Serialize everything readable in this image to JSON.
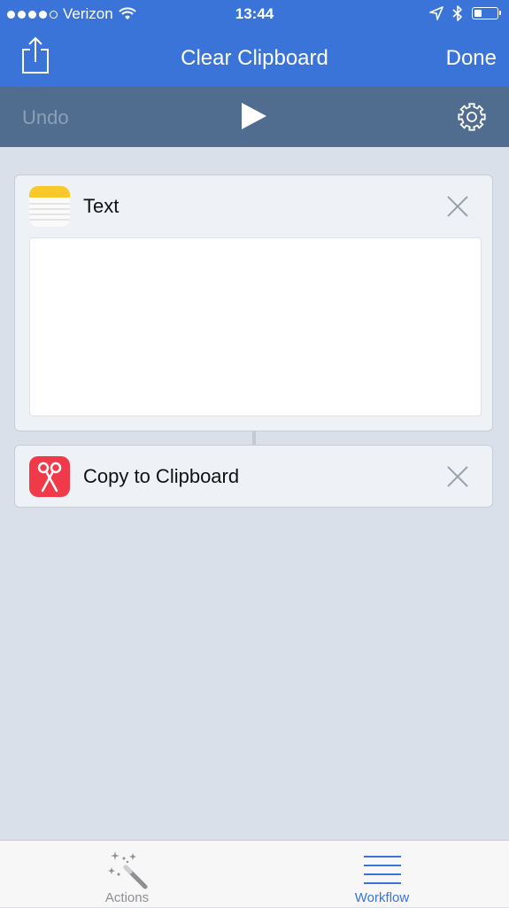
{
  "status_bar": {
    "carrier": "Verizon",
    "time": "13:44",
    "signal_filled": 4,
    "signal_total": 5,
    "battery_level": 0.35
  },
  "nav": {
    "title": "Clear Clipboard",
    "done_label": "Done",
    "share_icon": "share-icon"
  },
  "toolbar": {
    "undo_label": "Undo",
    "play_icon": "play-icon",
    "settings_icon": "gear-icon"
  },
  "actions": [
    {
      "label": "Text",
      "icon": "notes-icon",
      "text_value": ""
    },
    {
      "label": "Copy to Clipboard",
      "icon": "scissors-icon"
    }
  ],
  "tabs": [
    {
      "label": "Actions",
      "icon": "magic-wand-icon",
      "active": false
    },
    {
      "label": "Workflow",
      "icon": "list-icon",
      "active": true
    }
  ],
  "colors": {
    "accent": "#3a74d8",
    "toolbar": "#506d8f",
    "background": "#d9e0ea",
    "clipboard_icon": "#f03a4a"
  }
}
